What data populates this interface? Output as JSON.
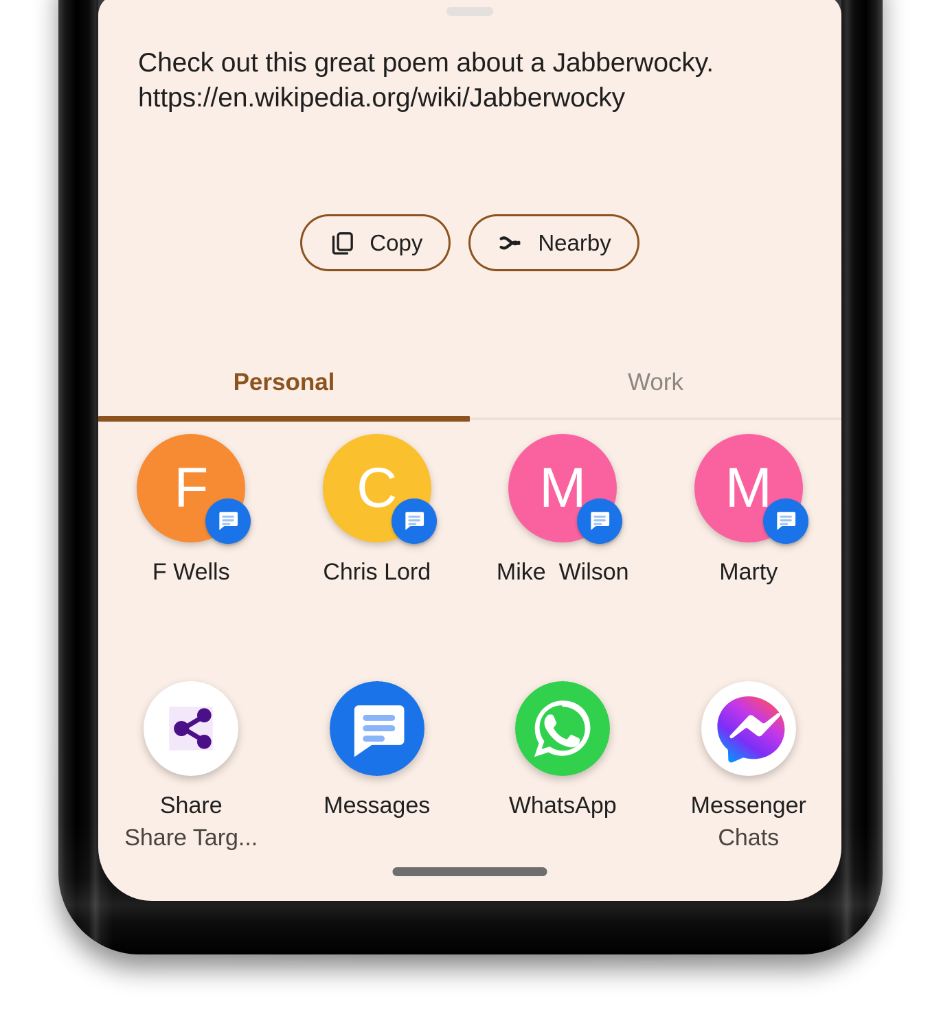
{
  "share_sheet": {
    "drag_handle": "drag-handle",
    "preview": {
      "message": "Check out this great poem about a Jabberwocky.",
      "url": "https://en.wikipedia.org/wiki/Jabberwocky"
    },
    "actions": [
      {
        "label": "Copy",
        "icon": "copy-icon"
      },
      {
        "label": "Nearby",
        "icon": "nearby-share-icon"
      }
    ],
    "tabs": [
      {
        "label": "Personal",
        "selected": true
      },
      {
        "label": "Work",
        "selected": false
      }
    ],
    "contacts": [
      {
        "name": "F Wells",
        "initial": "F",
        "color": "#F68B33",
        "badge": "messages-icon"
      },
      {
        "name": "Chris Lord",
        "initial": "C",
        "color": "#FBC02D",
        "badge": "messages-icon"
      },
      {
        "name": "Mike  Wilson",
        "initial": "M",
        "color": "#F9629F",
        "badge": "messages-icon"
      },
      {
        "name": "Marty",
        "initial": "M",
        "color": "#F9629F",
        "badge": "messages-icon"
      }
    ],
    "apps": [
      {
        "name": "Share",
        "subtitle": "Share Targ...",
        "icon": "share-nodes-icon"
      },
      {
        "name": "Messages",
        "subtitle": "",
        "icon": "messages-app-icon"
      },
      {
        "name": "WhatsApp",
        "subtitle": "",
        "icon": "whatsapp-icon"
      },
      {
        "name": "Messenger",
        "subtitle": "Chats",
        "icon": "messenger-icon"
      }
    ],
    "home_indicator": "home-indicator"
  },
  "colors": {
    "sheet_background": "#FBEEE6",
    "accent_brown": "#8C5320",
    "tab_inactive": "#8D8781",
    "badge_blue": "#1A73E8",
    "screen_background": "#3A3A3A"
  }
}
